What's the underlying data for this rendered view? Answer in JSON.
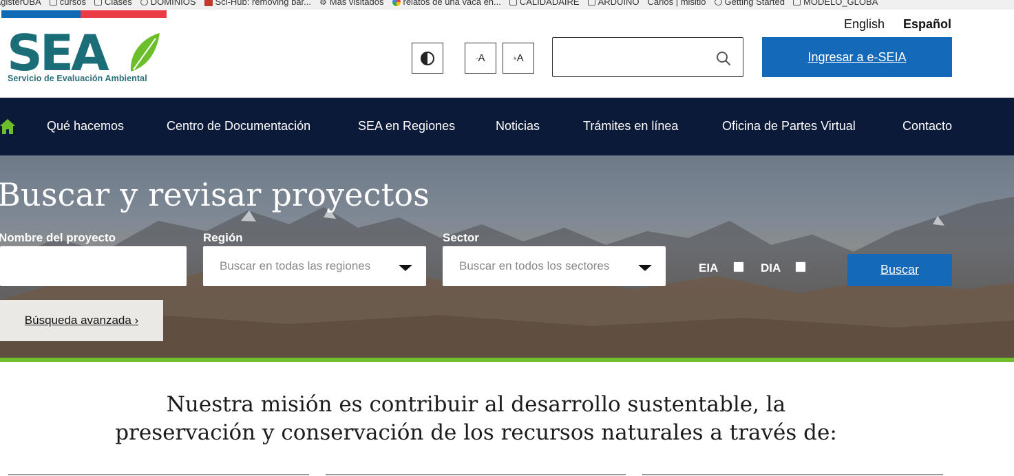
{
  "bookmarks": [
    {
      "label": "agisterUBA",
      "icon": "none"
    },
    {
      "label": "cursos",
      "icon": "folder-icon"
    },
    {
      "label": "Clases",
      "icon": "folder-icon"
    },
    {
      "label": "DOMINIOS",
      "icon": "globe-icon"
    },
    {
      "label": "Sci-Hub: removing bar...",
      "icon": "pdf-icon"
    },
    {
      "label": "Más visitados",
      "icon": "gear-icon"
    },
    {
      "label": "relatos de una vaca en...",
      "icon": "google-icon"
    },
    {
      "label": "CALIDADAIRE",
      "icon": "folder-icon"
    },
    {
      "label": "ARDUINO",
      "icon": "folder-icon"
    },
    {
      "label": "Carlos | misitio",
      "icon": "none"
    },
    {
      "label": "Getting Started",
      "icon": "globe-icon"
    },
    {
      "label": "MODELO_GLOBA",
      "icon": "folder-icon"
    }
  ],
  "header": {
    "logo_text": "SEA",
    "logo_subtitle": "Servicio de Evaluación Ambiental",
    "lang_english": "English",
    "lang_spanish": "Español",
    "contrast_icon": "contrast-icon",
    "font_decrease_label": "A",
    "font_decrease_prefix": "-",
    "font_increase_label": "A",
    "font_increase_prefix": "+",
    "search_placeholder": "",
    "search_icon": "search-icon",
    "eseia_button": "Ingresar a e-SEIA",
    "colors": {
      "flag_blue": "#0f69b4",
      "flag_red": "#eb3c46",
      "button_blue": "#1469b8",
      "logo_teal": "#1b6e77",
      "logo_green": "#6cbf2b"
    }
  },
  "nav": {
    "home_icon": "home-icon",
    "items": [
      "Qué hacemos",
      "Centro de Documentación",
      "SEA en Regiones",
      "Noticias",
      "Trámites en línea",
      "Oficina de Partes Virtual",
      "Contacto"
    ],
    "background": "#0c1a3a"
  },
  "hero": {
    "title": "Buscar y revisar proyectos",
    "project_name_label": "Nombre del proyecto",
    "project_name_value": "",
    "region_label": "Región",
    "region_value": "Buscar en todas las regiones",
    "sector_label": "Sector",
    "sector_value": "Buscar en todos los sectores",
    "eia_label": "EIA",
    "eia_checked": false,
    "dia_label": "DIA",
    "dia_checked": false,
    "search_button": "Buscar",
    "advanced_link": "Búsqueda avanzada ›",
    "accent_line_color": "#6cbf2b"
  },
  "mission": {
    "line1": "Nuestra misión es contribuir al desarrollo sustentable, la",
    "line2": "preservación y conservación de los recursos naturales a través de:"
  }
}
